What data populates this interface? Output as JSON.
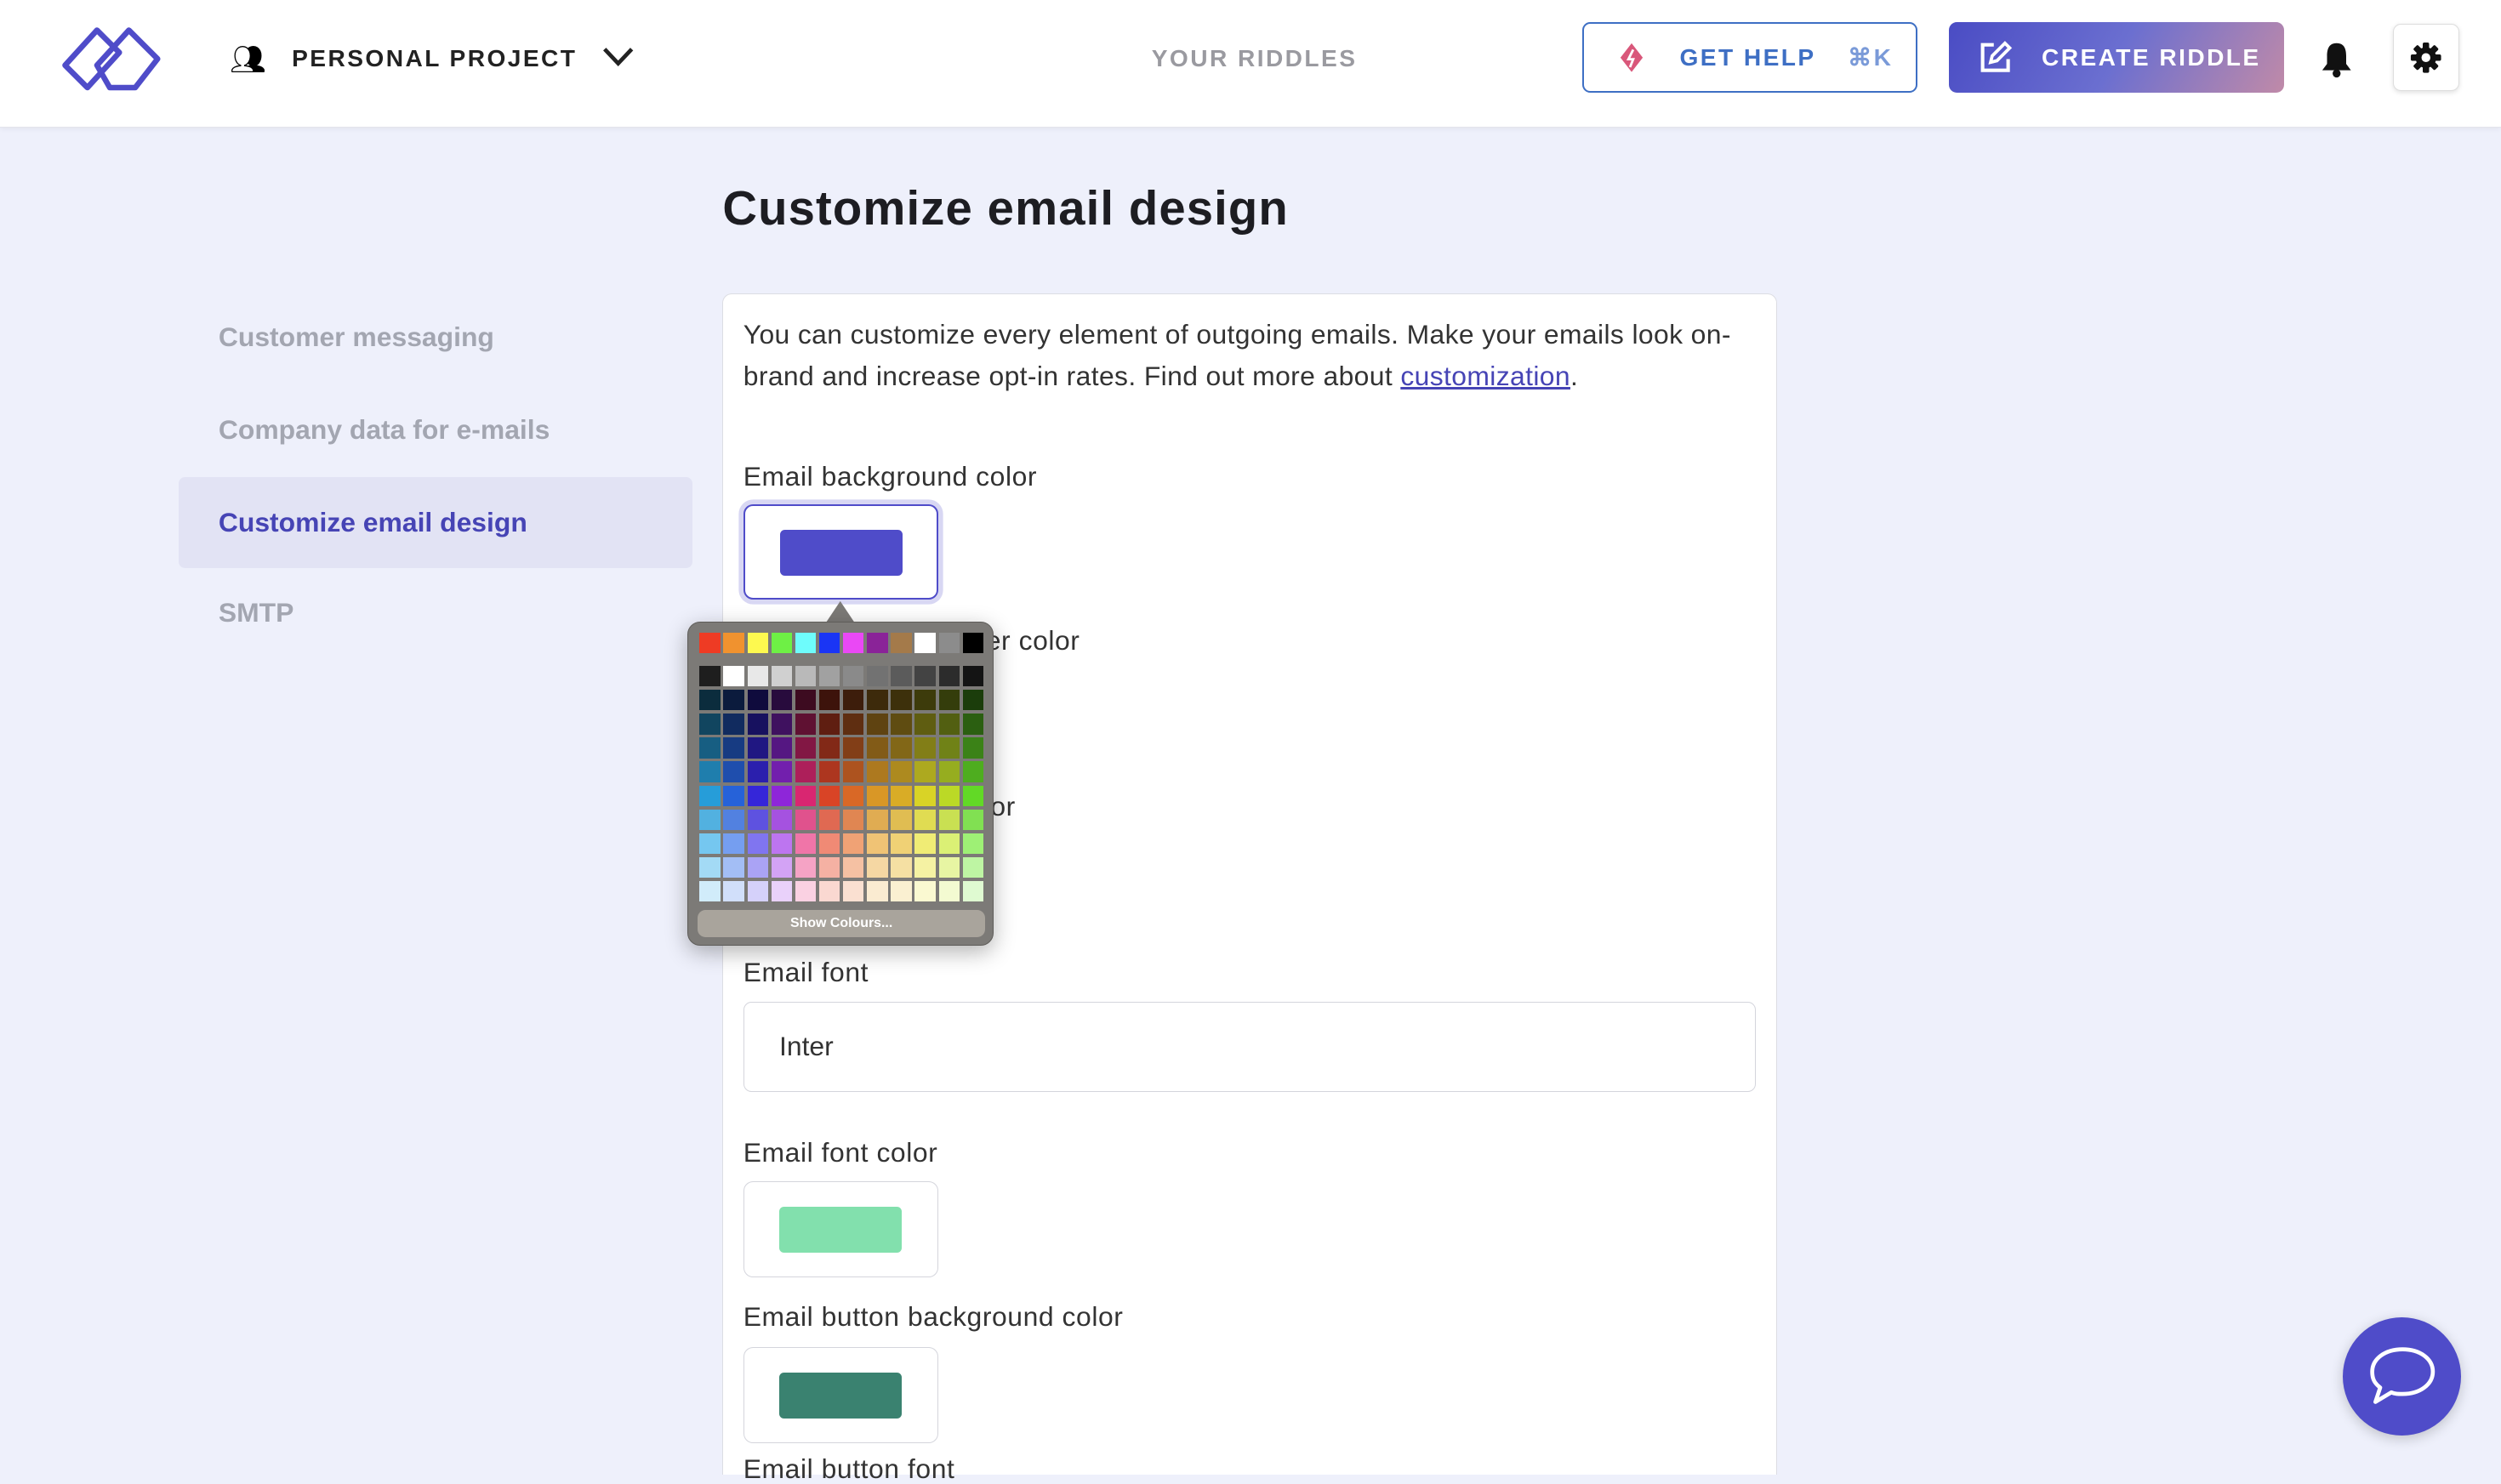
{
  "header": {
    "project": "PERSONAL PROJECT",
    "nav_link": "YOUR RIDDLES",
    "help_label": "GET HELP",
    "help_shortcut": "⌘K",
    "create_label": "CREATE RIDDLE",
    "logo_color": "#4f4cc9"
  },
  "sidebar": {
    "items": [
      {
        "label": "Customer messaging"
      },
      {
        "label": "Company data for e-mails"
      },
      {
        "label": "Customize email design",
        "active": true
      },
      {
        "label": "SMTP"
      }
    ]
  },
  "main": {
    "title": "Customize email design",
    "intro": "You can customize every element of outgoing emails. Make your emails look on-brand and increase opt-in rates. Find out more about ",
    "intro_link": "customization",
    "intro_end": ".",
    "fields": {
      "bg_label": "Email background color",
      "bg_color": "#4f4cc9",
      "partial_label_1": "er color",
      "partial_label_2": "or",
      "font_label": "Email font",
      "font_value": "Inter",
      "font_color_label": "Email font color",
      "font_color": "#82e0ad",
      "button_bg_label": "Email button background color",
      "button_bg_color": "#3a8270",
      "next_label": "Email button font"
    }
  },
  "color_picker": {
    "recent": [
      "#ee3b24",
      "#f0922f",
      "#fdf94f",
      "#6ef045",
      "#6efcfc",
      "#1a35f5",
      "#ea48f5",
      "#8a2398",
      "#a47a4a",
      "#ffffff",
      "#8c8c8c",
      "#000000"
    ],
    "show_colours_label": "Show Colours..."
  },
  "chat": {
    "color": "#4f4cc9"
  }
}
